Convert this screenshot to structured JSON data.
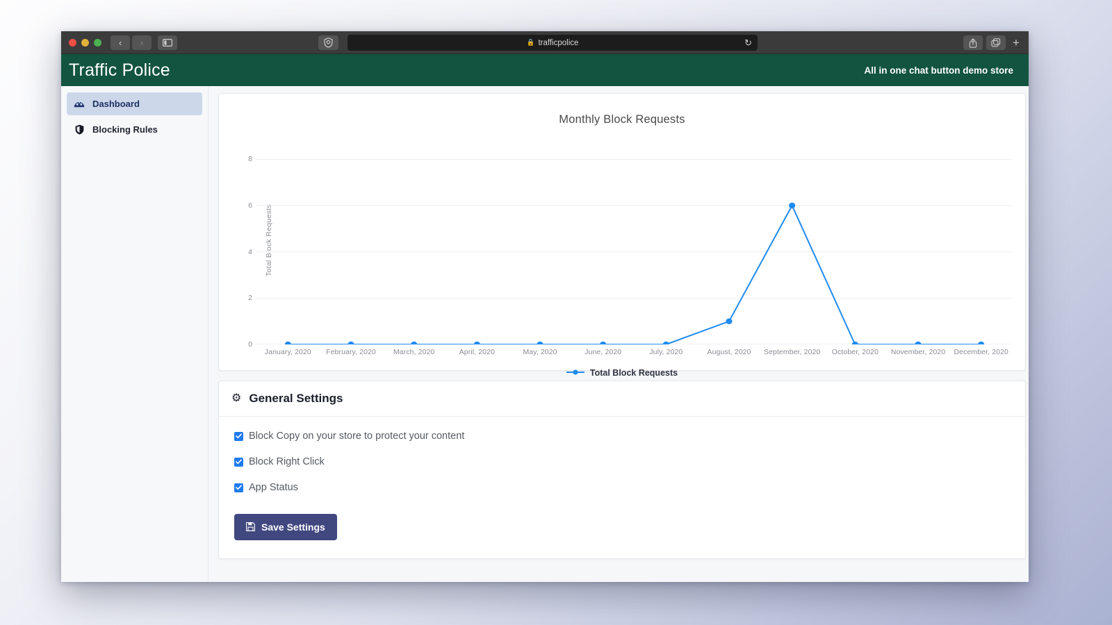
{
  "browser": {
    "traffic_lights": [
      "close",
      "minimize",
      "maximize"
    ],
    "back_icon": "‹",
    "forward_icon": "›",
    "sidebar_icon": "sidebar-toggle-icon",
    "shield_icon": "shield-icon",
    "url": "trafficpolice",
    "lock_icon": "🔒",
    "reload_icon": "↻",
    "share_icon": "share-icon",
    "tabs_icon": "tabs-icon",
    "new_tab_icon": "+"
  },
  "header": {
    "title": "Traffic Police",
    "store_name": "All in one chat button demo store"
  },
  "sidebar": {
    "items": [
      {
        "label": "Dashboard",
        "icon": "dashboard-icon",
        "active": true
      },
      {
        "label": "Blocking Rules",
        "icon": "shield-icon",
        "active": false
      }
    ]
  },
  "chart_data": {
    "type": "line",
    "title": "Monthly Block Requests",
    "xlabel": "",
    "ylabel": "Total Block Requests",
    "categories": [
      "January, 2020",
      "February, 2020",
      "March, 2020",
      "April, 2020",
      "May, 2020",
      "June, 2020",
      "July, 2020",
      "August, 2020",
      "September, 2020",
      "October, 2020",
      "November, 2020",
      "December, 2020"
    ],
    "series": [
      {
        "name": "Total Block Requests",
        "values": [
          0,
          0,
          0,
          0,
          0,
          0,
          0,
          1,
          6,
          0,
          0,
          0
        ],
        "color": "#1f8bf0"
      }
    ],
    "ylim": [
      0,
      9
    ],
    "yticks": [
      0,
      2,
      4,
      6,
      8
    ],
    "grid": true,
    "legend_position": "bottom",
    "legend": [
      "Total Block Requests"
    ]
  },
  "settings": {
    "title": "General Settings",
    "gear_icon": "gear-icon",
    "checkboxes": [
      {
        "label": "Block Copy on your store to protect your content",
        "checked": true
      },
      {
        "label": "Block Right Click",
        "checked": true
      },
      {
        "label": "App Status",
        "checked": true
      }
    ],
    "save_label": "Save Settings",
    "save_icon": "save-icon"
  },
  "colors": {
    "header_green": "#12543f",
    "accent_blue": "#1f8bf0",
    "save_button": "#41477f",
    "sidebar_active": "#ccd8ea"
  }
}
